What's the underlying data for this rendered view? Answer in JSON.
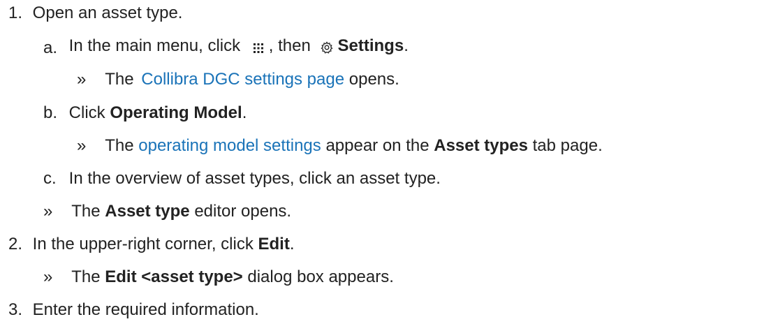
{
  "steps": {
    "s1": {
      "num": "1.",
      "text": "Open an asset type."
    },
    "s1a": {
      "num": "a.",
      "t1": "In the main menu, click",
      "t2": ", then",
      "bold": "Settings",
      "t3": "."
    },
    "s1a_result": {
      "arrow": "»",
      "t1": "The",
      "link": "Collibra DGC settings page",
      "t2": "opens."
    },
    "s1b": {
      "num": "b.",
      "t1": "Click",
      "bold": "Operating Model",
      "t2": "."
    },
    "s1b_result": {
      "arrow": "»",
      "t1": "The",
      "link": "operating model settings",
      "t2": "appear on the",
      "bold": "Asset types",
      "t3": "tab page."
    },
    "s1c": {
      "num": "c.",
      "text": "In the overview of asset types, click an asset type."
    },
    "s1_result": {
      "arrow": "»",
      "t1": "The",
      "bold": "Asset type",
      "t2": "editor opens."
    },
    "s2": {
      "num": "2.",
      "t1": "In the upper-right corner, click",
      "bold": "Edit",
      "t2": "."
    },
    "s2_result": {
      "arrow": "»",
      "t1": "The",
      "bold": "Edit <asset type>",
      "t2": "dialog box appears."
    },
    "s3": {
      "num": "3.",
      "text": "Enter the required information."
    }
  },
  "icons": {
    "apps": "apps-grid-icon",
    "settings": "gear-icon"
  },
  "colors": {
    "text": "#222222",
    "link": "#1a73b8"
  }
}
